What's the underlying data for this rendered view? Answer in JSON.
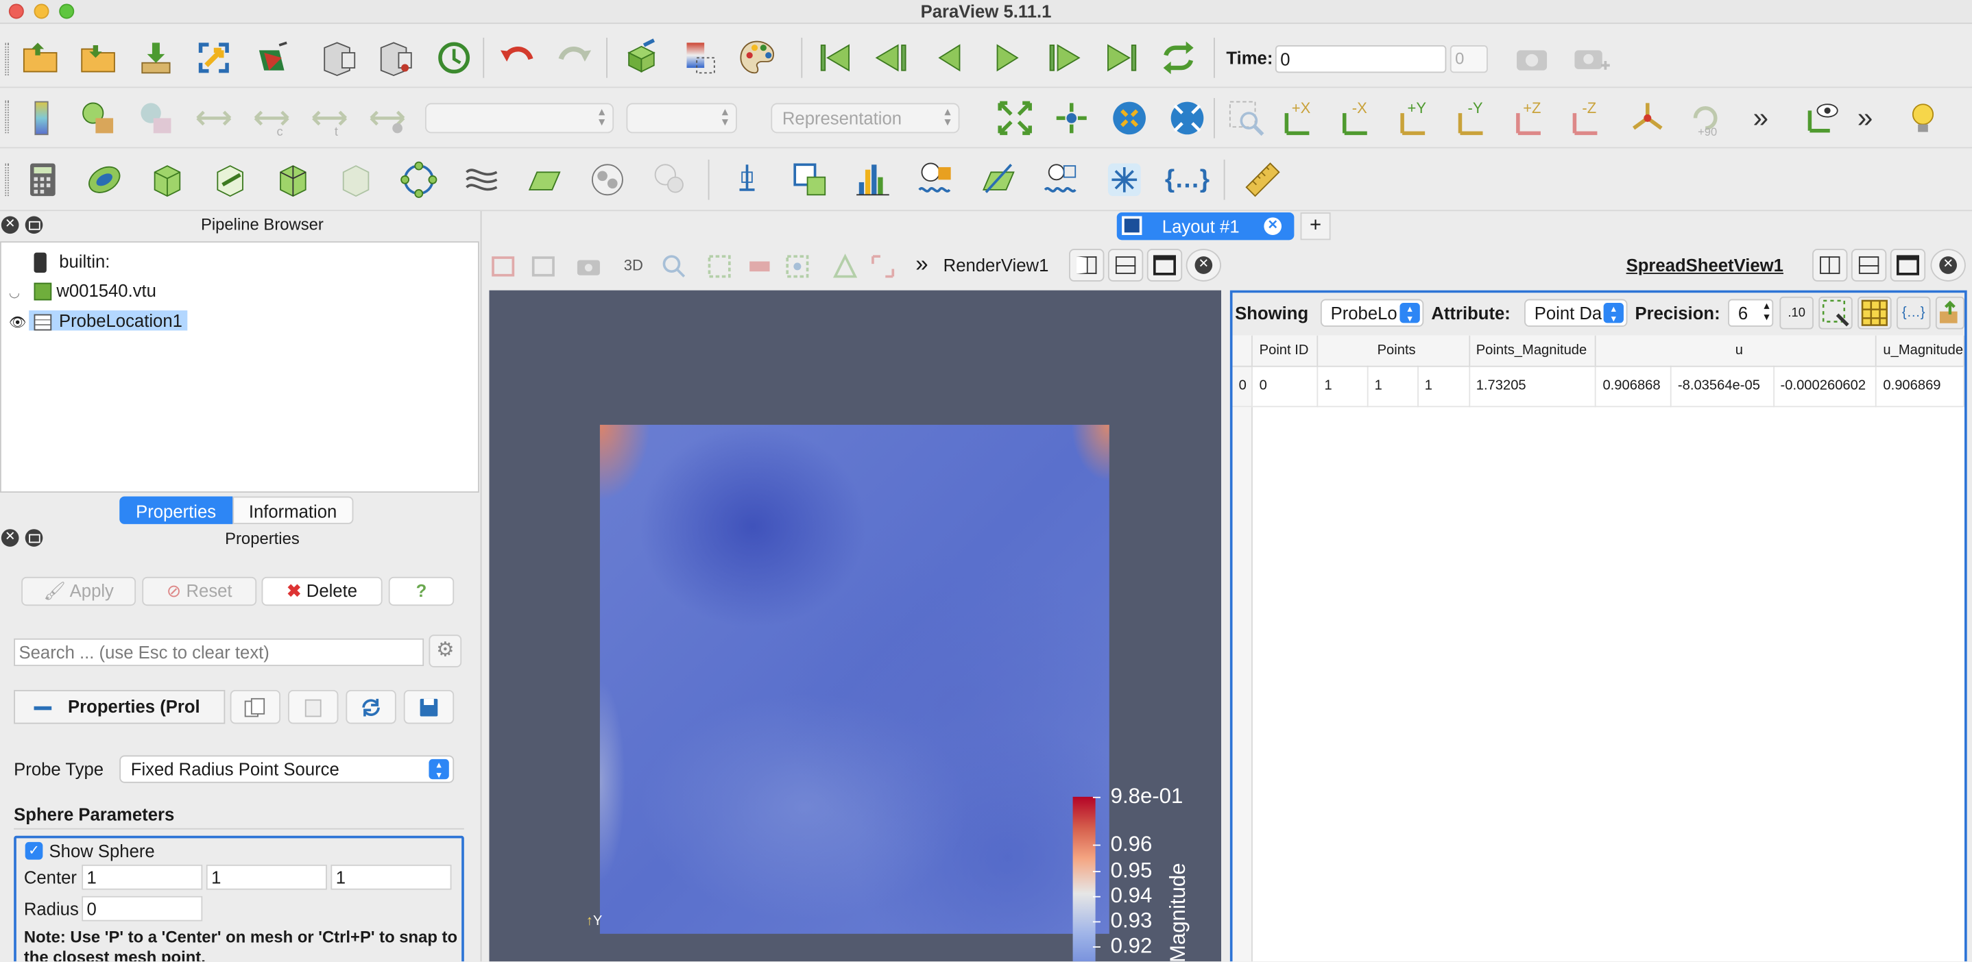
{
  "app": {
    "title": "ParaView 5.11.1"
  },
  "toolbar1": {
    "time_label": "Time:",
    "time_value": "0",
    "time_index": "0"
  },
  "toolbar2": {
    "representation_placeholder": "Representation",
    "axis_labels": [
      "+X",
      "-X",
      "+Y",
      "-Y",
      "+Z",
      "-Z"
    ],
    "rotate_label": "+90"
  },
  "pipeline": {
    "title": "Pipeline Browser",
    "items": [
      {
        "label": "builtin:"
      },
      {
        "label": "w001540.vtu"
      },
      {
        "label": "ProbeLocation1"
      }
    ]
  },
  "tabs": {
    "properties": "Properties",
    "information": "Information"
  },
  "properties": {
    "title": "Properties",
    "apply": "Apply",
    "reset": "Reset",
    "delete": "Delete",
    "help": "?",
    "search_placeholder": "Search ... (use Esc to clear text)",
    "section_label": "Properties (Prol",
    "probe_type_label": "Probe Type",
    "probe_type_value": "Fixed Radius Point Source",
    "sphere_params_title": "Sphere Parameters",
    "show_sphere_label": "Show Sphere",
    "center_label": "Center",
    "center_values": [
      "1",
      "1",
      "1"
    ],
    "radius_label": "Radius",
    "radius_value": "0",
    "note": "Note: Use 'P' to a 'Center' on mesh or 'Ctrl+P' to snap to the closest mesh point."
  },
  "layout": {
    "tab_label": "Layout #1",
    "plus": "+"
  },
  "render_view": {
    "label": "RenderView1",
    "mode_3d": "3D",
    "colorbar": {
      "labels": [
        "9.8e-01",
        "0.96",
        "0.95",
        "0.94",
        "0.93",
        "0.92"
      ],
      "title": "Magnitude"
    },
    "axis_y": "Y"
  },
  "spreadsheet": {
    "label": "SpreadSheetView1",
    "showing_label": "Showing",
    "showing_value": "ProbeLo",
    "attribute_label": "Attribute:",
    "attribute_value": "Point Da",
    "precision_label": "Precision:",
    "precision_value": "6",
    "columns": [
      "Point ID",
      "Points",
      "Points_Magnitude",
      "u",
      "u_Magnitude"
    ],
    "row": {
      "index": "0",
      "point_id": "0",
      "points": [
        "1",
        "1",
        "1"
      ],
      "points_magnitude": "1.73205",
      "u": [
        "0.906868",
        "-8.03564e-05",
        "-0.000260602"
      ],
      "u_magnitude": "0.906869"
    }
  }
}
